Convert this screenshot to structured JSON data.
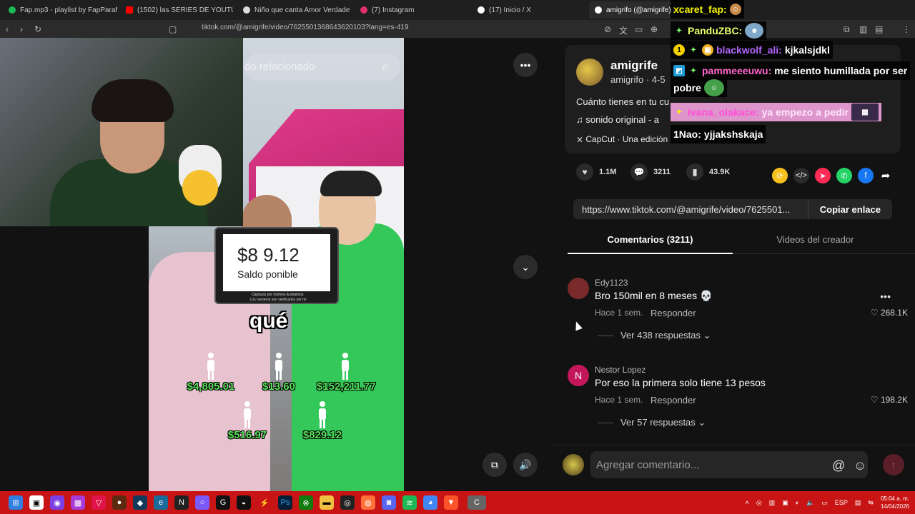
{
  "browser": {
    "tabs": [
      {
        "label": "Fap.mp3 - playlist by FapParaMoar | S",
        "color": "#1db954"
      },
      {
        "label": "(1502) las SERIES DE YOUTUBERS me",
        "color": "#ff0000"
      },
      {
        "label": "Niño que canta Amor Verdadero",
        "color": "#dddddd"
      },
      {
        "label": "(7) Instagram",
        "color": "#e1306c"
      },
      {
        "label": "(17) Inicio / X",
        "color": "#ffffff"
      },
      {
        "label": "amigrifo (@amigrife) | T",
        "color": "#ffffff"
      }
    ],
    "url": "tiktok.com/@amigrife/video/7625501368643620103?lang=es-419"
  },
  "video": {
    "search_text": "do relacionado",
    "balance_amount": "$8  9.12",
    "balance_label": "Saldo    ponible",
    "balance_note_1": "Capturas por motivos ilustrativos.",
    "balance_note_2": "Los numeros son verificados por mi",
    "caption": "qué",
    "people": [
      {
        "amount": "$4,805.01"
      },
      {
        "amount": "$13.60"
      },
      {
        "amount": "$152,211.77"
      },
      {
        "amount": "$516.97"
      },
      {
        "amount": "$829.12"
      }
    ]
  },
  "post": {
    "author_name": "amigrife",
    "author_sub": "amigrifo · 4-5",
    "description": "Cuánto tienes en tu cu",
    "sound": "sonido original - a",
    "capcut": "CapCut · Una edición",
    "likes": "1.1M",
    "comments": "3211",
    "saves": "43.9K",
    "link": "https://www.tiktok.com/@amigrife/video/7625501...",
    "copy_label": "Copiar enlace"
  },
  "tabs": {
    "comments": "Comentarios (3211)",
    "creator_videos": "Videos del creador"
  },
  "comments": [
    {
      "user": "Edy1123",
      "text": "Bro 150mil en 8 meses 💀",
      "time": "Hace 1 sem.",
      "reply": "Responder",
      "likes": "268.1K",
      "more": "Ver 438 respuestas",
      "avatar_color": "#7a2a2a"
    },
    {
      "user": "Nestor Lopez",
      "text": "Por eso la primera solo tiene 13 pesos",
      "time": "Hace 1 sem.",
      "reply": "Responder",
      "likes": "198.2K",
      "more": "Ver 57 respuestas",
      "avatar_letter": "N",
      "avatar_color": "#c2185b"
    }
  ],
  "composer": {
    "placeholder": "Agregar comentario..."
  },
  "chat": [
    {
      "user": "xcaret_fap:",
      "text": "",
      "user_color": "#f5f500"
    },
    {
      "user": "PanduZBC:",
      "text": "",
      "user_color": "#e8ff6a"
    },
    {
      "user": "blackwolf_ali:",
      "text": "kjkalsjdkl",
      "user_color": "#b366ff"
    },
    {
      "user": "pammeeeuwu:",
      "text": "me siento humillada por ser",
      "user_color": "#ff66cc"
    },
    {
      "user": "",
      "text": "pobre",
      "user_color": "#ffffff"
    },
    {
      "user": "ivana_olakace:",
      "text": "ya empezo a pedir",
      "user_color": "#ff4fd8"
    },
    {
      "user": "1Nao:",
      "text": "yjjakshskaja",
      "user_color": "#ffffff"
    }
  ],
  "taskbar": {
    "lang": "ESP",
    "time": "05:04 a. m.",
    "date": "14/04/2026"
  }
}
